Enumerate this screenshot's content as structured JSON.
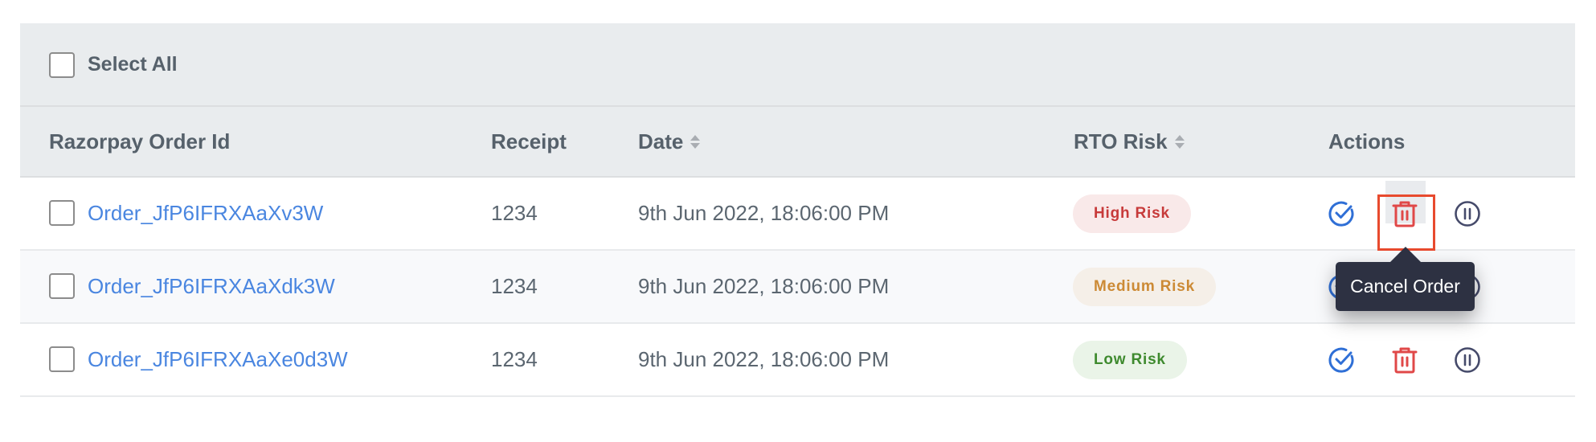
{
  "select_all": {
    "label": "Select All",
    "checked": false
  },
  "columns": [
    {
      "label": "Razorpay Order Id",
      "sortable": false
    },
    {
      "label": "Receipt",
      "sortable": false
    },
    {
      "label": "Date",
      "sortable": true
    },
    {
      "label": "RTO Risk",
      "sortable": true
    },
    {
      "label": "Actions",
      "sortable": false
    }
  ],
  "rows": [
    {
      "order_id": "Order_JfP6IFRXAaXv3W",
      "receipt": "1234",
      "date": "9th Jun 2022, 18:06:00 PM",
      "risk": "High Risk",
      "risk_level": "high"
    },
    {
      "order_id": "Order_JfP6IFRXAaXdk3W",
      "receipt": "1234",
      "date": "9th Jun 2022, 18:06:00 PM",
      "risk": "Medium Risk",
      "risk_level": "medium"
    },
    {
      "order_id": "Order_JfP6IFRXAaXe0d3W",
      "receipt": "1234",
      "date": "9th Jun 2022, 18:06:00 PM",
      "risk": "Low Risk",
      "risk_level": "low"
    }
  ],
  "actions": {
    "approve_icon": "circle-check-icon",
    "cancel_icon": "trash-icon",
    "hold_icon": "pause-circle-icon"
  },
  "tooltip": {
    "text": "Cancel Order"
  },
  "colors": {
    "link": "#4a86e0",
    "approve": "#2f6fd6",
    "cancel": "#e04848",
    "hold": "#454a6a",
    "highlight": "#e84a2e",
    "tooltip_bg": "#2d3142"
  }
}
